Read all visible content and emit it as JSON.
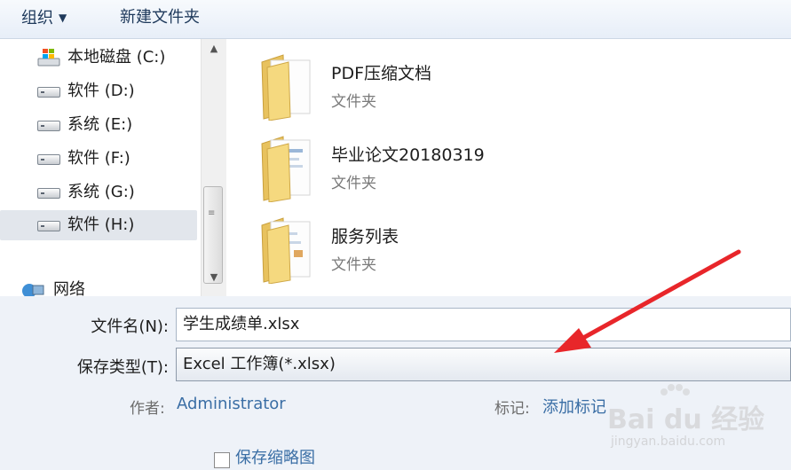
{
  "toolbar": {
    "organize": "组织",
    "new_folder": "新建文件夹"
  },
  "nav": {
    "items": [
      {
        "label": "本地磁盘 (C:)",
        "icon": "windows-drive-icon"
      },
      {
        "label": "软件 (D:)",
        "icon": "drive-icon"
      },
      {
        "label": "系统 (E:)",
        "icon": "drive-icon"
      },
      {
        "label": "软件 (F:)",
        "icon": "drive-icon"
      },
      {
        "label": "系统 (G:)",
        "icon": "drive-icon"
      },
      {
        "label": "软件 (H:)",
        "icon": "drive-icon",
        "selected": true
      }
    ],
    "network": "网络"
  },
  "files": [
    {
      "name": "PDF压缩文档",
      "type": "文件夹"
    },
    {
      "name": "毕业论文20180319",
      "type": "文件夹"
    },
    {
      "name": "服务列表",
      "type": "文件夹"
    }
  ],
  "form": {
    "filename_label": "文件名(N):",
    "filename_value": "学生成绩单.xlsx",
    "filetype_label": "保存类型(T):",
    "filetype_value": "Excel 工作簿(*.xlsx)",
    "author_label": "作者:",
    "author_value": "Administrator",
    "tags_label": "标记:",
    "tags_value": "添加标记",
    "thumbnail_label": "保存缩略图"
  },
  "watermark": {
    "brand": "Bai du 经验",
    "url": "jingyan.baidu.com"
  },
  "colors": {
    "link": "#3a6ea5",
    "arrow": "#e8262a",
    "folder": "#f3d479"
  }
}
